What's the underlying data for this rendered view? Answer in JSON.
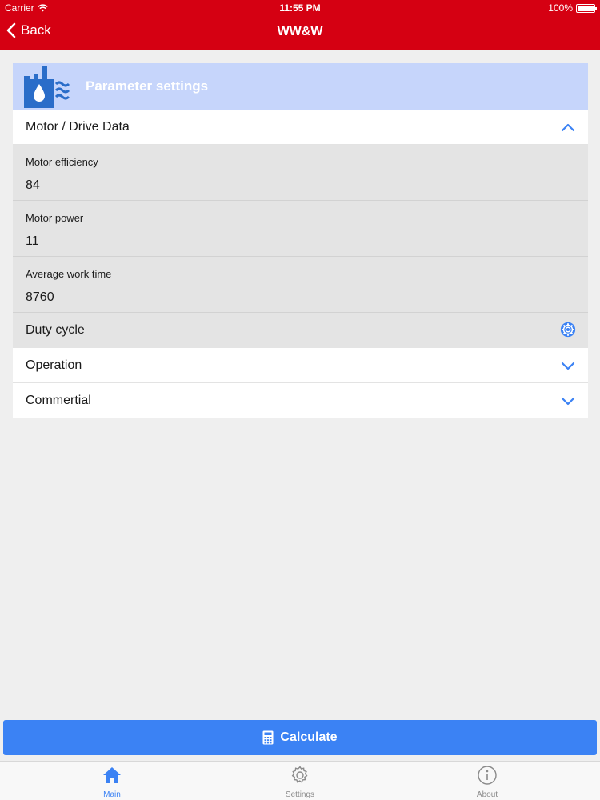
{
  "status_bar": {
    "carrier": "Carrier",
    "time": "11:55 PM",
    "battery": "100%"
  },
  "nav": {
    "back_label": "Back",
    "title": "WW&W"
  },
  "panel": {
    "title": "Parameter settings",
    "sections": [
      {
        "label": "Motor / Drive Data",
        "expanded": true
      },
      {
        "label": "Operation",
        "expanded": false
      },
      {
        "label": "Commertial",
        "expanded": false
      }
    ],
    "fields": [
      {
        "label": "Motor efficiency",
        "value": "84"
      },
      {
        "label": "Motor power",
        "value": "11"
      },
      {
        "label": "Average work time",
        "value": "8760"
      }
    ],
    "duty_cycle_label": "Duty cycle"
  },
  "calculate_label": "Calculate",
  "tabs": [
    {
      "label": "Main",
      "icon": "home-icon",
      "active": true
    },
    {
      "label": "Settings",
      "icon": "gear-icon",
      "active": false
    },
    {
      "label": "About",
      "icon": "info-icon",
      "active": false
    }
  ],
  "colors": {
    "header_red": "#d50012",
    "accent_blue": "#3b82f4",
    "panel_head_blue": "#c6d5fb"
  }
}
